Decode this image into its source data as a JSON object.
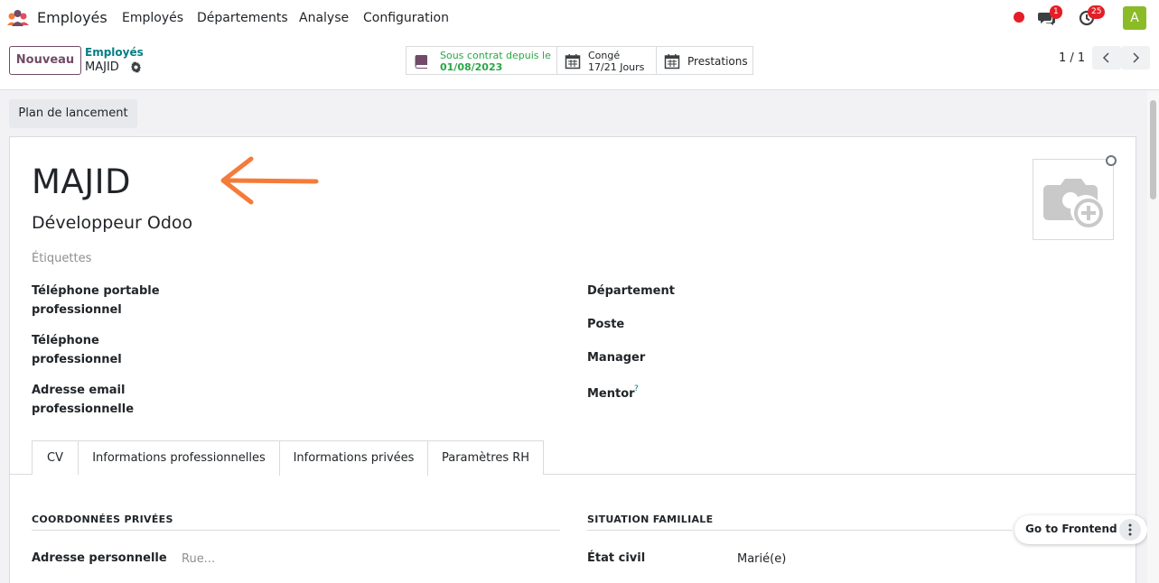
{
  "nav": {
    "app_title": "Employés",
    "menu": [
      "Employés",
      "Départements",
      "Analyse",
      "Configuration"
    ],
    "messages_count": "1",
    "activities_count": "25",
    "avatar_letter": "A"
  },
  "control": {
    "new_button": "Nouveau",
    "breadcrumb_parent": "Employés",
    "breadcrumb_current": "MAJID",
    "smart_buttons": [
      {
        "line1": "Sous contrat depuis le",
        "line2": "01/08/2023",
        "icon": "book-icon"
      },
      {
        "line1": "Congé",
        "line2": "17/21 Jours",
        "icon": "calendar-icon"
      },
      {
        "line1": "Prestations",
        "line2": "",
        "icon": "calendar-icon"
      }
    ],
    "pager": "1 / 1"
  },
  "action_button": "Plan de lancement",
  "employee": {
    "name": "MAJID",
    "job_title": "Développeur Odoo",
    "tags_placeholder": "Étiquettes"
  },
  "left_fields": [
    {
      "line1": "Téléphone portable",
      "line2": "professionnel"
    },
    {
      "line1": "Téléphone",
      "line2": "professionnel"
    },
    {
      "line1": "Adresse email",
      "line2": "professionnelle"
    }
  ],
  "right_fields": [
    "Département",
    "Poste",
    "Manager",
    "Mentor"
  ],
  "mentor_help": "?",
  "tabs": [
    {
      "label": "CV",
      "active": false
    },
    {
      "label": "Informations professionnelles",
      "active": false
    },
    {
      "label": "Informations privées",
      "active": true
    },
    {
      "label": "Paramètres RH",
      "active": false
    }
  ],
  "private_section": {
    "title": "COORDONNÉES PRIVÉES",
    "address_label": "Adresse personnelle",
    "address_placeholder": "Rue..."
  },
  "family_section": {
    "title": "SITUATION FAMILIALE",
    "marital_label": "État civil",
    "marital_value": "Marié(e)"
  },
  "frontend_button": "Go to Frontend",
  "colors": {
    "brand": "#714b67",
    "accent_teal": "#017e84",
    "contract_green": "#28a745",
    "annotation_arrow": "#f47b3a",
    "badge_red": "#e41e26",
    "avatar_green": "#8bbb26"
  }
}
